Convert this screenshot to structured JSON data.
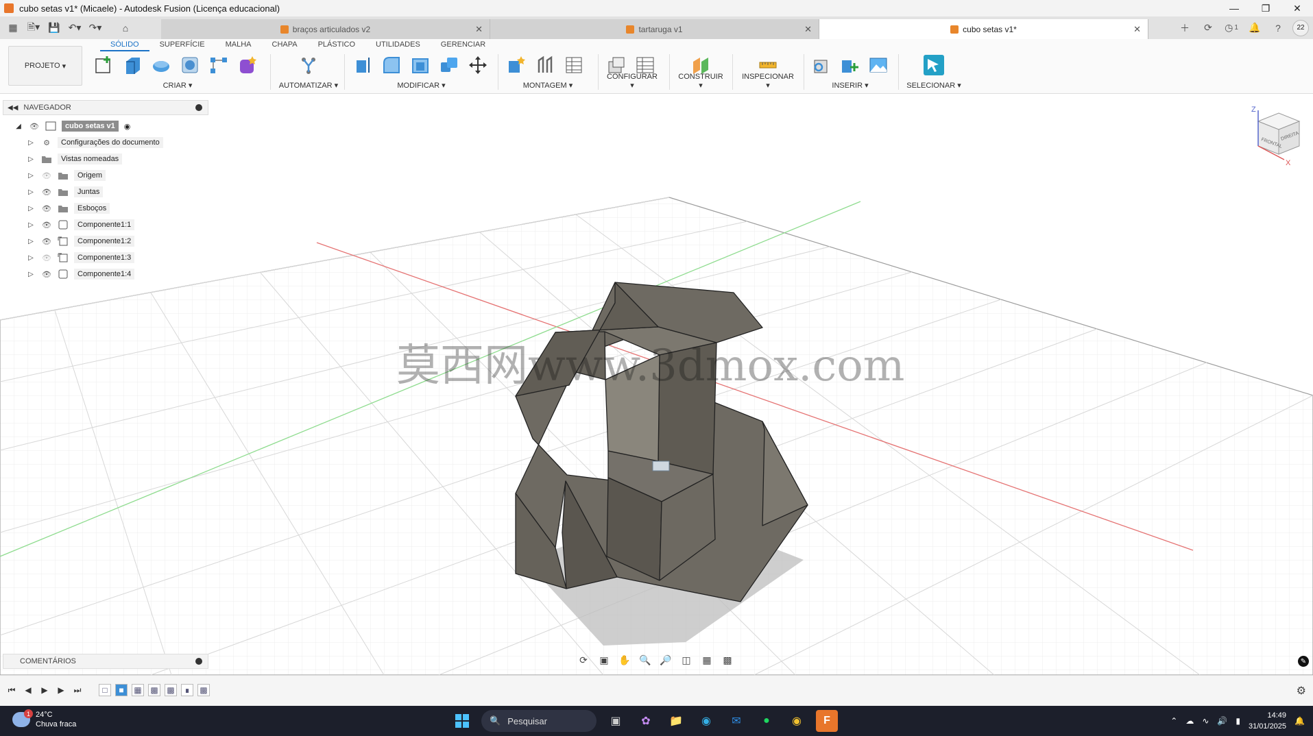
{
  "window": {
    "title": "cubo setas v1* (Micaele) - Autodesk Fusion (Licença educacional)"
  },
  "doc_tabs": [
    {
      "label": "braços articulados v2",
      "active": false
    },
    {
      "label": "tartaruga v1",
      "active": false
    },
    {
      "label": "cubo setas v1*",
      "active": true
    }
  ],
  "header_right": {
    "notifications": "1",
    "user_initials": "22"
  },
  "ribbon": {
    "project_label": "PROJETO",
    "tabs": [
      "SÓLIDO",
      "SUPERFÍCIE",
      "MALHA",
      "CHAPA",
      "PLÁSTICO",
      "UTILIDADES",
      "GERENCIAR"
    ],
    "groups": {
      "criar": "CRIAR",
      "automatizar": "AUTOMATIZAR",
      "modificar": "MODIFICAR",
      "montagem": "MONTAGEM",
      "configurar": "CONFIGURAR",
      "construir": "CONSTRUIR",
      "inspecionar": "INSPECIONAR",
      "inserir": "INSERIR",
      "selecionar": "SELECIONAR"
    }
  },
  "navigator": {
    "title": "NAVEGADOR",
    "root": "cubo setas v1",
    "items": [
      {
        "label": "Configurações do documento",
        "icon": "gear-icon"
      },
      {
        "label": "Vistas nomeadas",
        "icon": "folder-icon"
      },
      {
        "label": "Origem",
        "icon": "folder-icon"
      },
      {
        "label": "Juntas",
        "icon": "folder-icon"
      },
      {
        "label": "Esboços",
        "icon": "folder-icon"
      },
      {
        "label": "Componente1:1",
        "icon": "component-icon"
      },
      {
        "label": "Componente1:2",
        "icon": "component-link-icon"
      },
      {
        "label": "Componente1:3",
        "icon": "component-link-icon"
      },
      {
        "label": "Componente1:4",
        "icon": "component-icon"
      }
    ]
  },
  "watermark": "莫西网www.3dmox.com",
  "viewcube": {
    "frente": "FRONTAL",
    "direita": "DIREITA",
    "z": "Z",
    "x": "X"
  },
  "comments_label": "COMENTÁRIOS",
  "taskbar": {
    "weather_temp": "24°C",
    "weather_desc": "Chuva fraca",
    "weather_badge": "1",
    "search_placeholder": "Pesquisar",
    "time": "14:49",
    "date": "31/01/2025"
  }
}
